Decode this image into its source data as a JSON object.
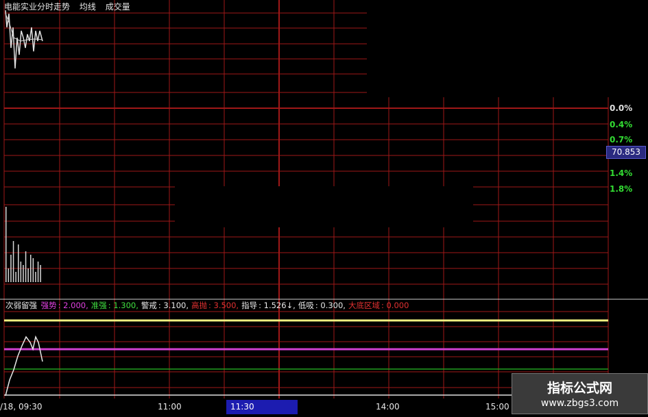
{
  "header": {
    "stock_name": "电能实业分时走势",
    "legend_avg": "均线",
    "legend_volume": "成交量"
  },
  "price_axis": {
    "labels": [
      "0.0%",
      "0.4%",
      "0.7%",
      "1.4%",
      "1.8%"
    ],
    "label_color": "#33dd33",
    "current_price": "70.853"
  },
  "indicator": {
    "name": "次弱留强",
    "items": [
      {
        "label": "强势",
        "value": "2.000",
        "color": "#e040e0"
      },
      {
        "label": "准强",
        "value": "1.300",
        "color": "#40e040"
      },
      {
        "label": "警戒",
        "value": "3.100",
        "color": "#e8e8e8"
      },
      {
        "label": "高抛",
        "value": "3.500",
        "color": "#e03030"
      },
      {
        "label": "指导",
        "value": "1.526↓",
        "color": "#e8e8e8"
      },
      {
        "label": "低吸",
        "value": "0.300",
        "color": "#e8e8e8"
      },
      {
        "label": "大底区域",
        "value": "0.000",
        "color": "#e03030"
      }
    ],
    "line_colors": {
      "yellow": "#f0f080",
      "magenta": "#d040d0",
      "green": "#20a020",
      "white": "#e0e0e0"
    }
  },
  "time_axis": {
    "start": "/18, 09:30",
    "ticks": [
      "11:00",
      "14:00",
      "15:00"
    ],
    "active": "11:30"
  },
  "watermark": {
    "title": "指标公式网",
    "url": "www.zbgs3.com"
  },
  "colors": {
    "grid": "#a01818",
    "background": "#000000"
  }
}
